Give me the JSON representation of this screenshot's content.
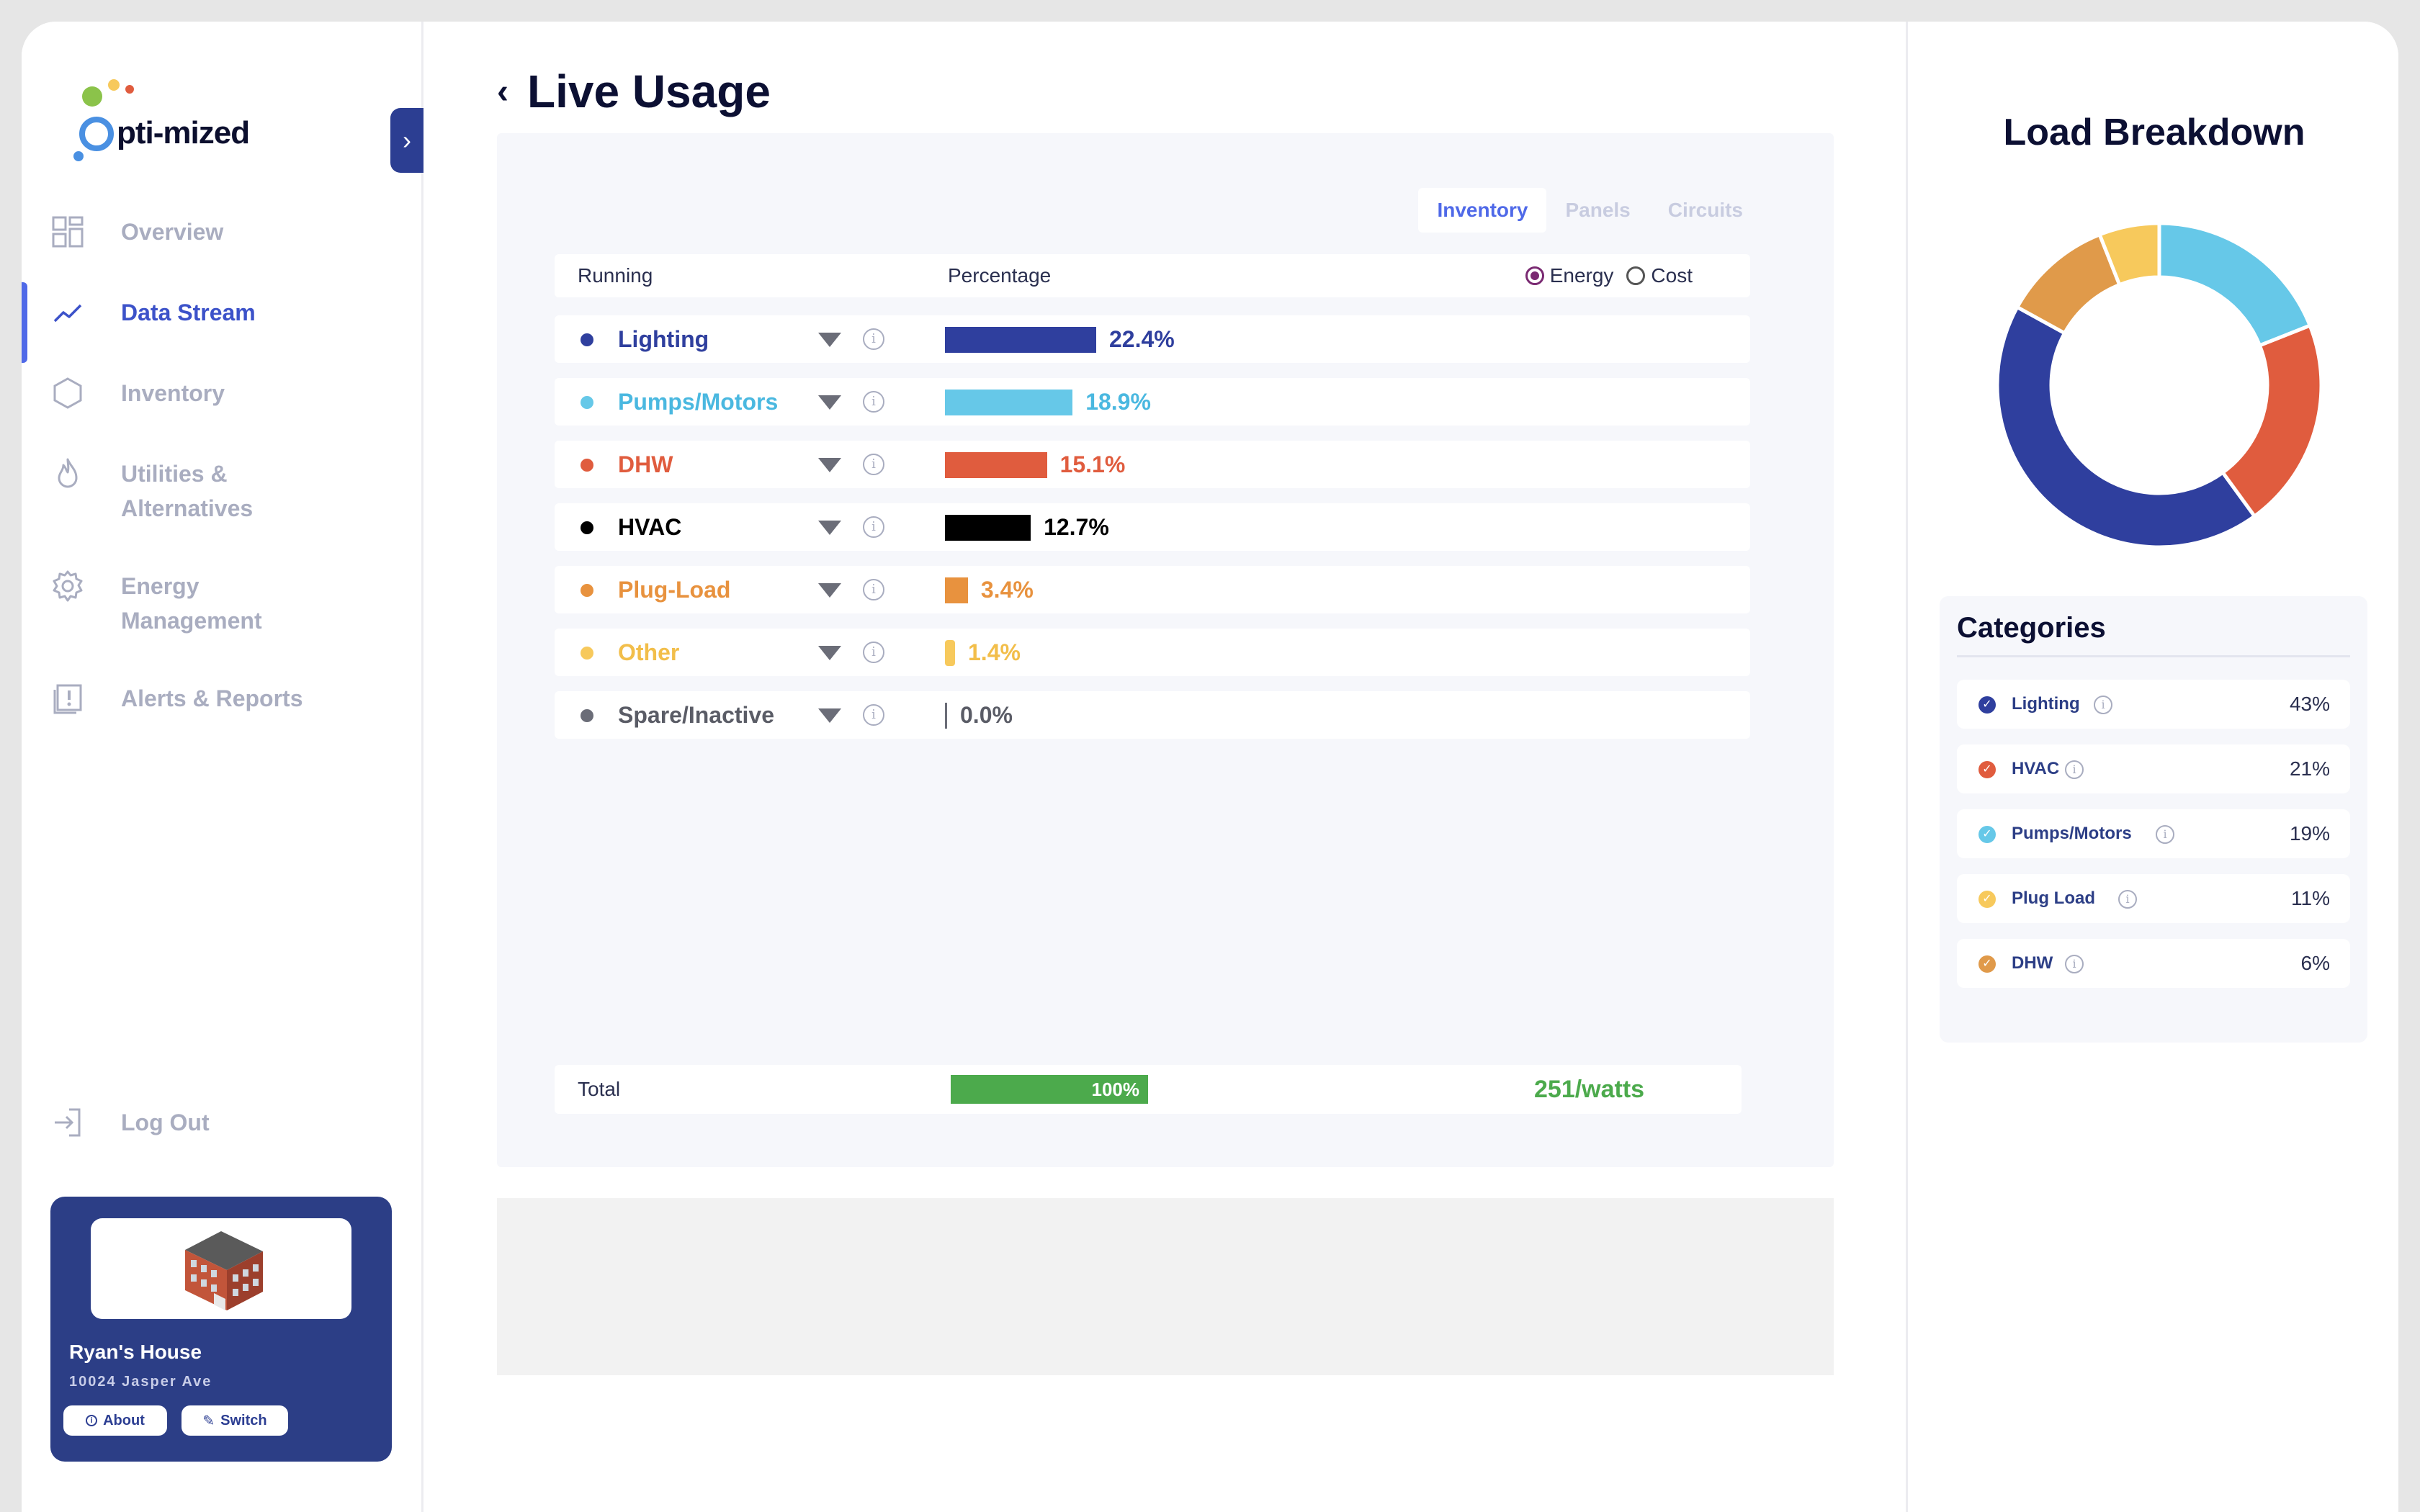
{
  "app": {
    "logo_text": "pti-mized",
    "logo_prefix": "O"
  },
  "sidebar": {
    "items": [
      {
        "label": "Overview",
        "icon": "grid-icon"
      },
      {
        "label": "Data Stream",
        "icon": "trend-line-icon",
        "active": true
      },
      {
        "label": "Inventory",
        "icon": "hexagon-icon"
      },
      {
        "label": "Utilities &\nAlternatives",
        "icon": "flame-icon"
      },
      {
        "label": "Energy\nManagement",
        "icon": "gear-icon"
      },
      {
        "label": "Alerts & Reports",
        "icon": "alert-report-icon"
      }
    ],
    "logout_label": "Log Out",
    "house": {
      "name": "Ryan's House",
      "address": "10024 Jasper Ave",
      "about_label": "About",
      "switch_label": "Switch"
    }
  },
  "main": {
    "title": "Live Usage",
    "tabs": [
      "Inventory",
      "Panels",
      "Circuits"
    ],
    "active_tab": "Inventory",
    "columns": {
      "running": "Running",
      "percentage": "Percentage"
    },
    "toggle": {
      "energy": "Energy",
      "cost": "Cost",
      "selected": "Energy"
    },
    "rows": [
      {
        "label": "Lighting",
        "pct_text": "22.4%",
        "pct": 22.4,
        "color": "#2f3f9e",
        "text_color": "#2f3f9e"
      },
      {
        "label": "Pumps/Motors",
        "pct_text": "18.9%",
        "pct": 18.9,
        "color": "#66c8e8",
        "text_color": "#4ab8e0"
      },
      {
        "label": "DHW",
        "pct_text": "15.1%",
        "pct": 15.1,
        "color": "#e05c3e",
        "text_color": "#e05c3e"
      },
      {
        "label": "HVAC",
        "pct_text": "12.7%",
        "pct": 12.7,
        "color": "#000000",
        "text_color": "#000000"
      },
      {
        "label": "Plug-Load",
        "pct_text": "3.4%",
        "pct": 3.4,
        "color": "#e8923e",
        "text_color": "#e8923e"
      },
      {
        "label": "Other",
        "pct_text": "1.4%",
        "pct": 1.4,
        "color": "#f7c95c",
        "text_color": "#f2be4a"
      },
      {
        "label": "Spare/Inactive",
        "pct_text": "0.0%",
        "pct": 0.0,
        "color": "#6b6d78",
        "text_color": "#5a5c66"
      }
    ],
    "total": {
      "label": "Total",
      "bar_text": "100%",
      "watts": "251/watts"
    }
  },
  "right": {
    "title": "Load Breakdown",
    "donut": [
      {
        "name": "Pumps/Motors",
        "value": 19,
        "color": "#66c8e8"
      },
      {
        "name": "HVAC",
        "value": 21,
        "color": "#e05c3e"
      },
      {
        "name": "Lighting",
        "value": 43,
        "color": "#2f3f9e"
      },
      {
        "name": "Plug Load",
        "value": 11,
        "color": "#e09a4a"
      },
      {
        "name": "DHW",
        "value": 6,
        "color": "#f7c95c"
      }
    ],
    "categories_title": "Categories",
    "categories": [
      {
        "label": "Lighting",
        "value": "43%",
        "color": "#2f3f9e"
      },
      {
        "label": "HVAC",
        "value": "21%",
        "color": "#e05c3e"
      },
      {
        "label": "Pumps/Motors",
        "value": "19%",
        "color": "#66c8e8"
      },
      {
        "label": "Plug Load",
        "value": "11%",
        "color": "#f7c95c"
      },
      {
        "label": "DHW",
        "value": "6%",
        "color": "#e09a4a"
      }
    ]
  }
}
